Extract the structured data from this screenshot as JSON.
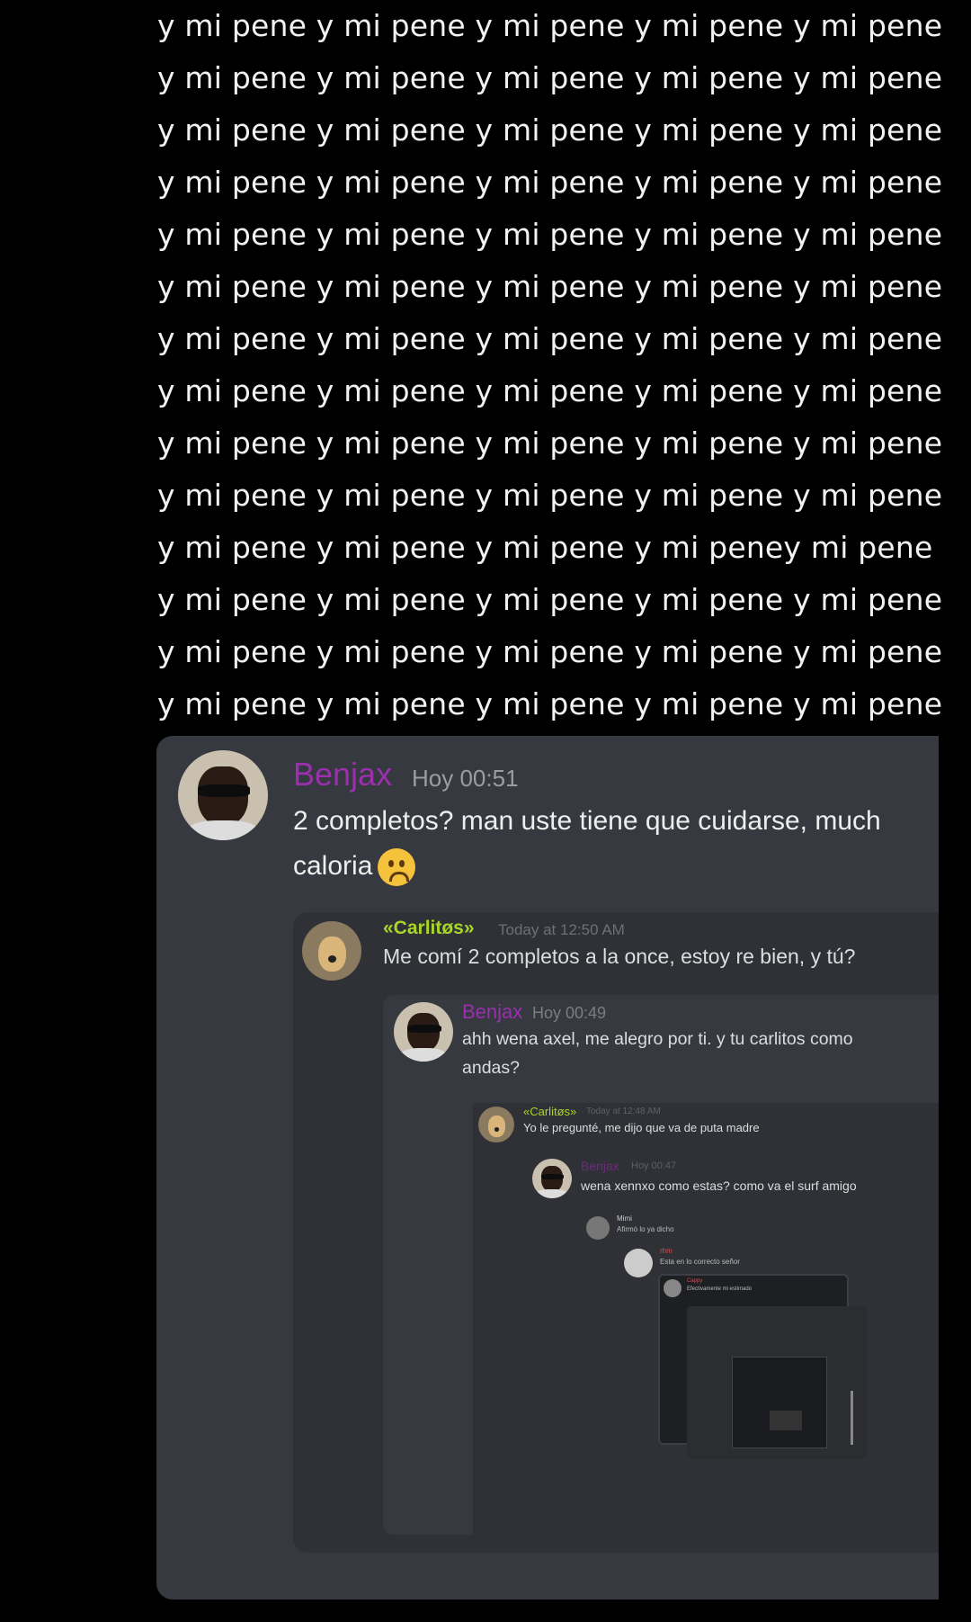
{
  "spam_lines": [
    "y mi pene y mi pene y mi pene y mi pene y mi pene",
    "y mi pene y mi pene y mi pene y mi pene y mi pene",
    "y mi pene y mi pene y mi pene y mi pene y mi pene",
    "y mi pene y mi pene y mi pene y mi pene y mi pene",
    "y mi pene y mi pene y mi pene y mi pene y mi pene",
    "y mi pene y mi pene y mi pene y mi pene y mi pene",
    "y mi pene y mi pene y mi pene y mi pene y mi pene",
    "y mi pene y mi pene y mi pene y mi pene y mi pene",
    "y mi pene y mi pene y mi pene y mi pene y mi pene",
    "y mi pene y mi pene y mi pene y mi pene y mi pene",
    "y mi pene y mi pene y mi pene y mi peney mi pene",
    "y mi pene y mi pene y mi pene y mi pene y mi pene",
    "y mi pene y mi pene y mi pene y mi pene y mi pene",
    "y mi pene y mi pene y mi pene y mi pene y mi pene"
  ],
  "message": {
    "author": "Benjax",
    "timestamp": "Hoy 00:51",
    "text": "2 completos? man uste tiene que cuidarse, much caloria",
    "emoji": "worried-face-emoji"
  },
  "quote1": {
    "author": "«Carlitøs»",
    "timestamp": "Today at 12:50 AM",
    "text": "Me comí 2 completos a la once, estoy re bien, y tú?"
  },
  "quote2": {
    "author": "Benjax",
    "timestamp": "Hoy 00:49",
    "text_line1": "ahh wena axel, me alegro por ti. y tu carlitos como",
    "text_line2": "andas?"
  },
  "quote3": {
    "author": "«Carlitøs»",
    "timestamp": "Today at 12:48 AM",
    "text": "Yo le pregunté, me dijo que va de puta madre"
  },
  "quote4": {
    "author": "Benjax",
    "timestamp": "Hoy 00:47",
    "text": "wena xennxo como estas? como va el surf amigo"
  },
  "quote5": {
    "author": "Mimi",
    "text": "Afirmó lo ya dicho"
  },
  "quote6": {
    "author": "rhm",
    "text": "Esta en lo correcto señor"
  },
  "quote7": {
    "author": "Cappy",
    "text": "Efectivamente mi estimado"
  },
  "colors": {
    "benjax": "#9b2fae",
    "carlitos": "#a8d52a",
    "background": "#000000",
    "card": "#36393f"
  }
}
